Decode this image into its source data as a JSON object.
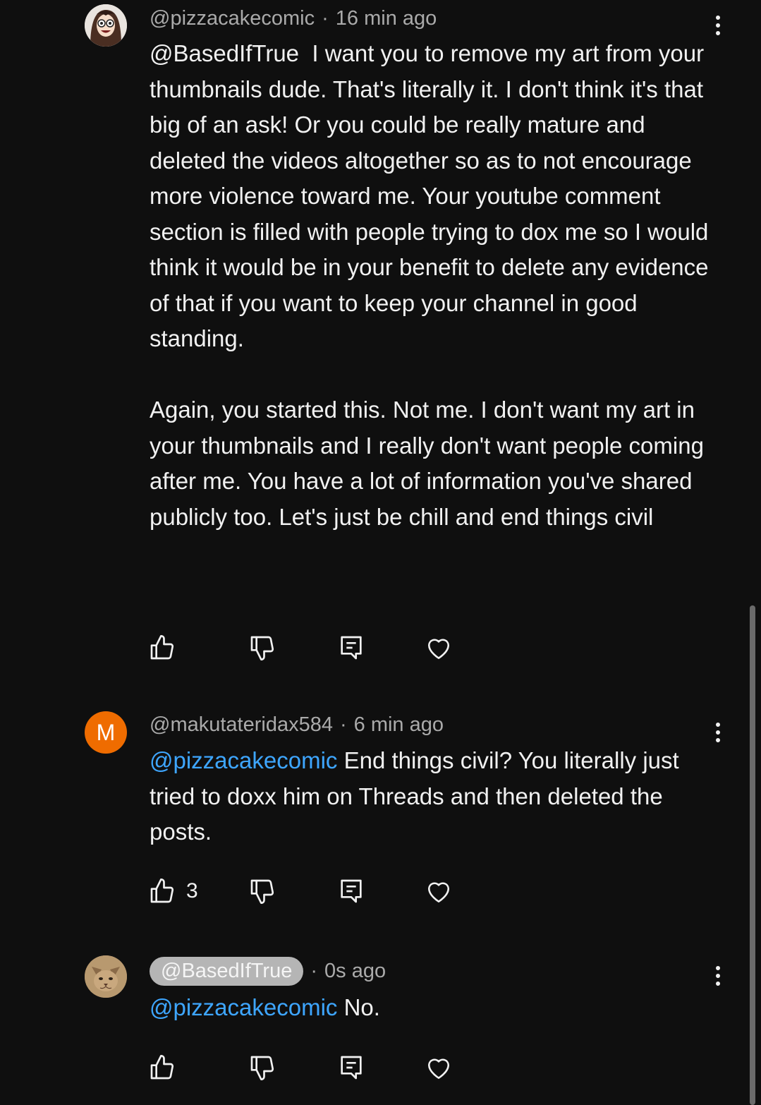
{
  "comments": [
    {
      "author": "@pizzacakecomic",
      "time": "16 min ago",
      "avatar_icon": "cartoon-woman-avatar",
      "mention": "@BasedIfTrue",
      "text": "  I want you to remove my art from your thumbnails dude. That's literally it. I don't think it's that big of an ask! Or you could be really mature and deleted the videos altogether so as to not encourage more violence toward me. Your youtube comment section is filled with people trying to dox me so I would think it would be in your benefit to delete any evidence of that if you want to keep your channel in good standing.\n\nAgain, you started this. Not me. I don't want my art in your thumbnails and I really don't want people coming after me. You have a lot of information you've shared publicly too. Let's just be chill and end things civil",
      "likes": ""
    },
    {
      "author": "@makutateridax584",
      "time": "6 min ago",
      "avatar_letter": "M",
      "avatar_color": "#ef6c00",
      "mention": "@pizzacakecomic",
      "text": " End things civil? You literally just tried to doxx him on Threads and then deleted the posts.",
      "likes": "3"
    },
    {
      "author": "@BasedIfTrue",
      "time": "0s ago",
      "avatar_icon": "cat-avatar",
      "mention": "@pizzacakecomic",
      "text": " No.",
      "likes": ""
    }
  ],
  "separator": "·",
  "icons": {
    "like": "thumbs-up-icon",
    "dislike": "thumbs-down-icon",
    "reply": "reply-icon",
    "heart": "heart-icon",
    "menu": "more-vert-icon"
  },
  "colors": {
    "background": "#0f0f0f",
    "mention": "#3ea6ff",
    "meta": "#aaaaaa"
  }
}
